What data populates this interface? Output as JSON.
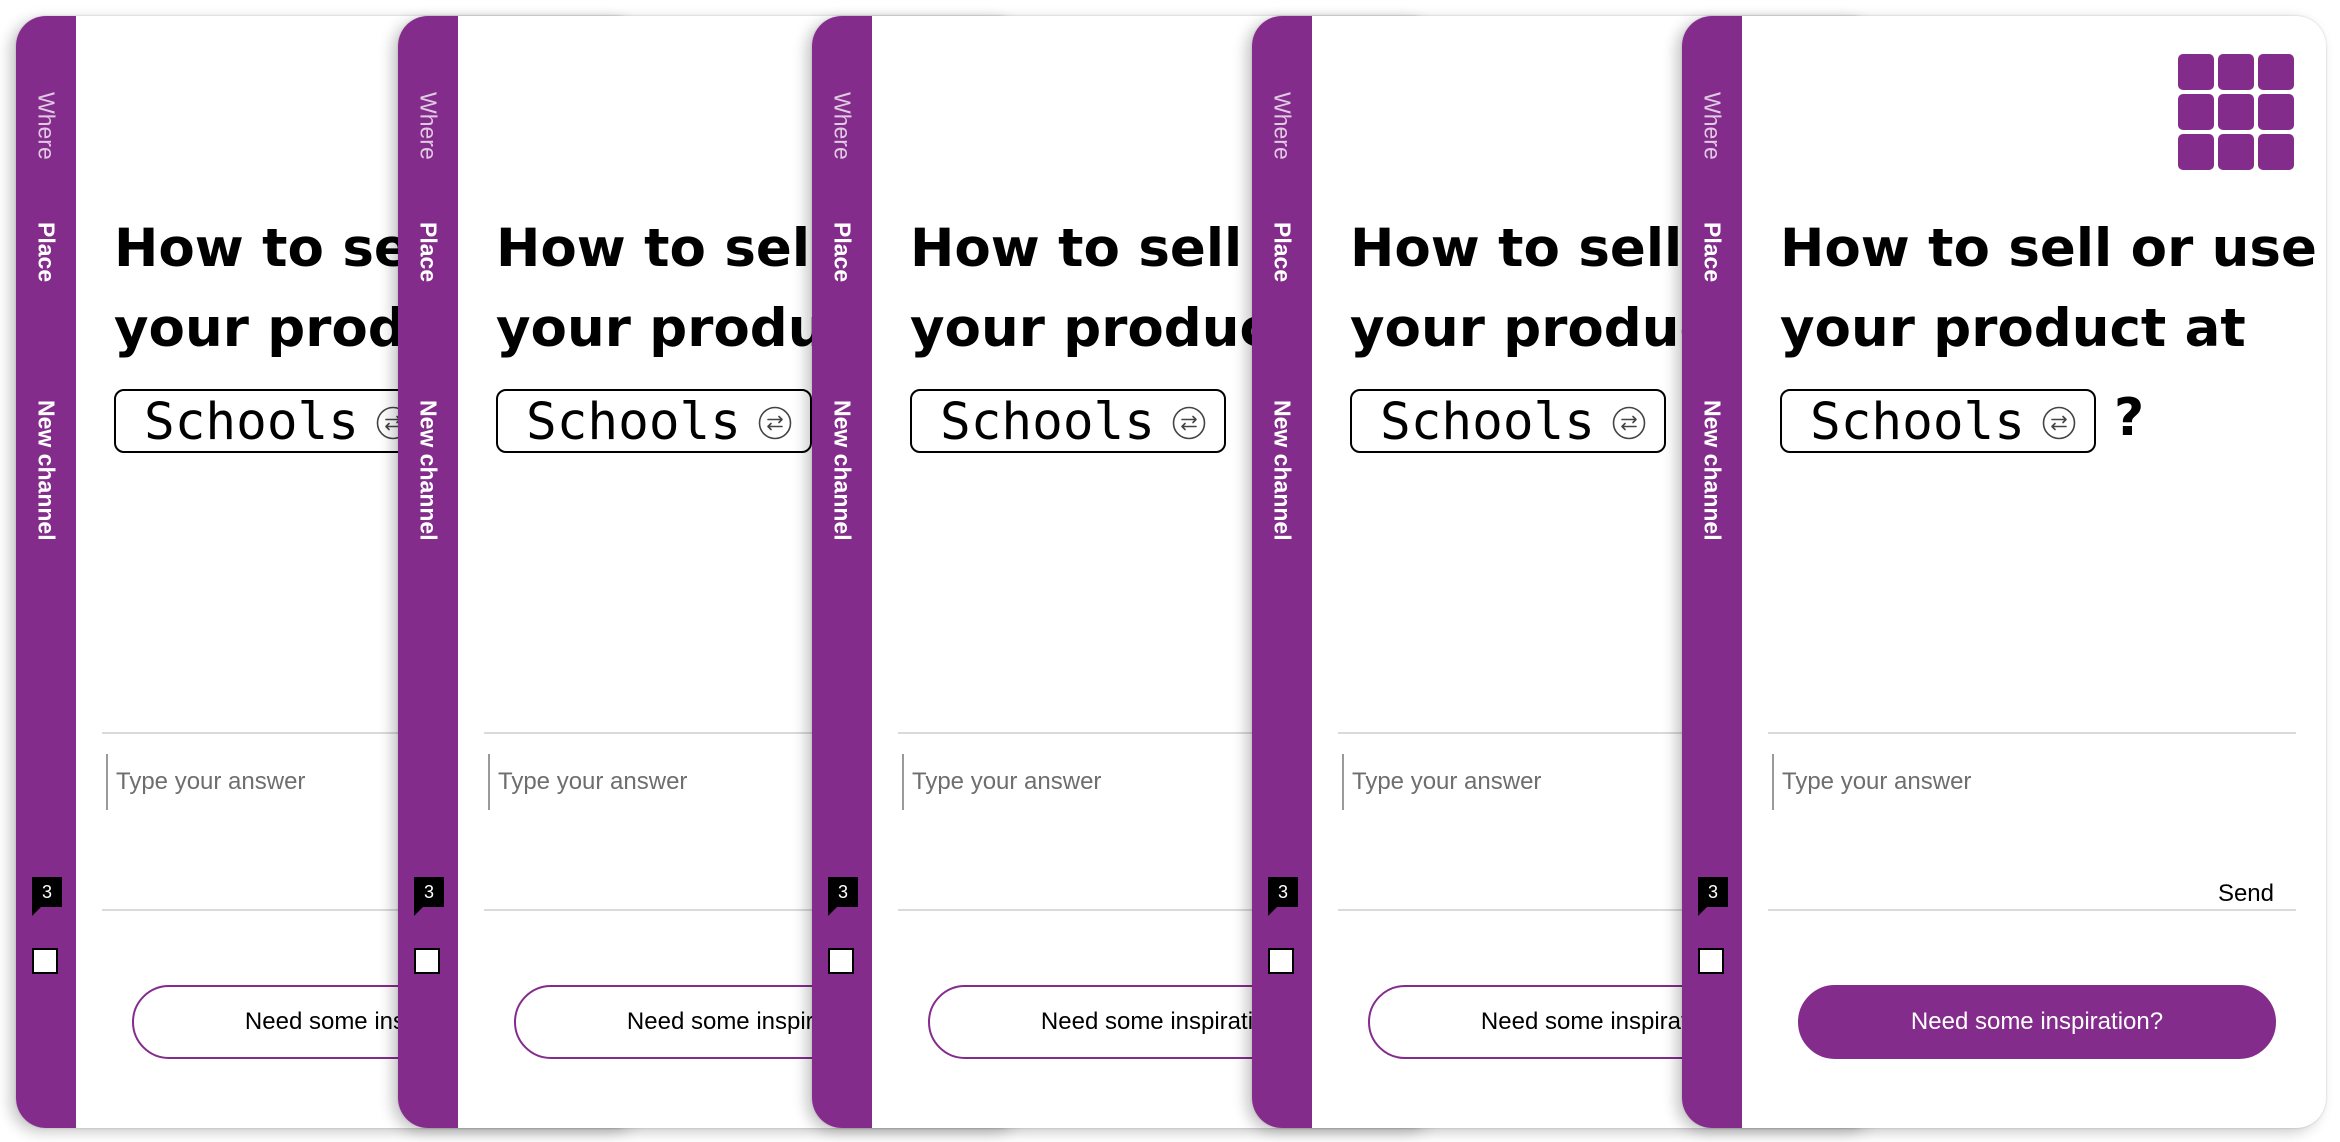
{
  "brand_color": "#842c8c",
  "rail": {
    "where": "Where",
    "place": "Place",
    "new_channel": "New channel",
    "badge_count": "3"
  },
  "card": {
    "question_line1": "How to sell or use",
    "question_line2": "your product at",
    "place_value": "Schools",
    "question_mark": "?",
    "answer_placeholder": "Type your answer",
    "send_label": "Send",
    "inspiration_label": "Need some inspiration?"
  },
  "icons": {
    "swap": "swap-arrows-icon",
    "logo": "plus-grid-logo-icon"
  }
}
